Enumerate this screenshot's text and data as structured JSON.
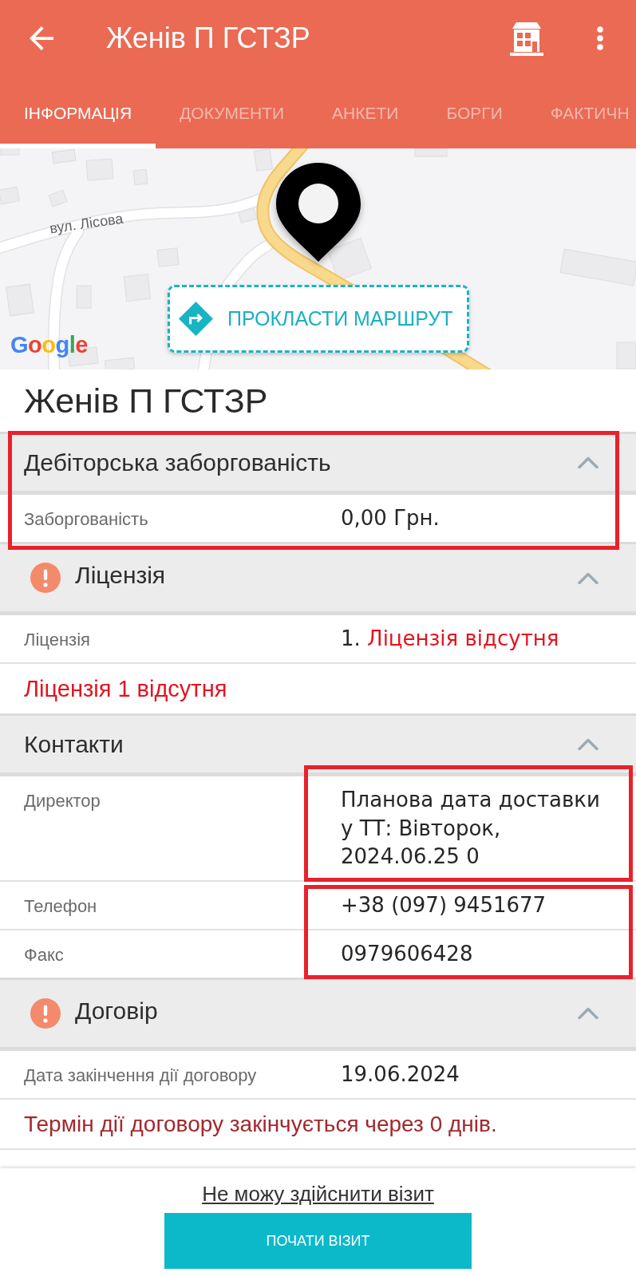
{
  "app_bar": {
    "title": "Женів П ГСТЗР"
  },
  "tabs": [
    {
      "label": "ІНФОРМАЦІЯ",
      "selected": true
    },
    {
      "label": "ДОКУМЕНТИ",
      "selected": false
    },
    {
      "label": "АНКЕТИ",
      "selected": false
    },
    {
      "label": "БОРГИ",
      "selected": false
    },
    {
      "label": "ФАКТИЧН",
      "selected": false
    }
  ],
  "map": {
    "street_label": "вул. Лісова",
    "route_button": "ПРОКЛАСТИ МАРШРУТ",
    "attribution": "Google"
  },
  "outlet_name": "Женів П ГСТЗР",
  "sections": [
    {
      "title": "Дебіторська заборгованість",
      "alert": false,
      "expanded": true,
      "framed": true,
      "groups": [
        {
          "values_framed": false,
          "items": [
            {
              "kind": "field",
              "label": "Заборгованість",
              "value": "0,00 Грн.",
              "error": false
            }
          ]
        }
      ]
    },
    {
      "title": "Ліцензія",
      "alert": true,
      "expanded": true,
      "framed": false,
      "groups": [
        {
          "values_framed": false,
          "items": [
            {
              "kind": "field",
              "label": "Ліцензія",
              "index": "1.",
              "value": "Ліцензія відсутня",
              "error": true
            },
            {
              "kind": "error",
              "text": "Ліцензія 1 відсутня"
            }
          ]
        }
      ]
    },
    {
      "title": "Контакти",
      "alert": false,
      "expanded": true,
      "framed": false,
      "groups": [
        {
          "values_framed": true,
          "items": [
            {
              "kind": "field",
              "label": "Директор",
              "value": "Планова дата доставки у ТТ: Вівторок, 2024.06.25 0",
              "error": false
            }
          ]
        },
        {
          "values_framed": true,
          "items": [
            {
              "kind": "field",
              "label": "Телефон",
              "value": "+38 (097) 9451677",
              "error": false
            },
            {
              "kind": "field",
              "label": "Факс",
              "value": "0979606428",
              "error": false
            }
          ]
        }
      ]
    },
    {
      "title": "Договір",
      "alert": true,
      "expanded": true,
      "framed": false,
      "groups": [
        {
          "values_framed": false,
          "items": [
            {
              "kind": "field",
              "label": "Дата закінчення дії договору",
              "value": "19.06.2024",
              "error": false
            },
            {
              "kind": "warning",
              "text": "Термін дії договору закінчується через 0 днів."
            }
          ]
        }
      ]
    }
  ],
  "footer": {
    "link": "Не можу здійснити візит",
    "button": "ПОЧАТИ ВІЗИТ"
  }
}
